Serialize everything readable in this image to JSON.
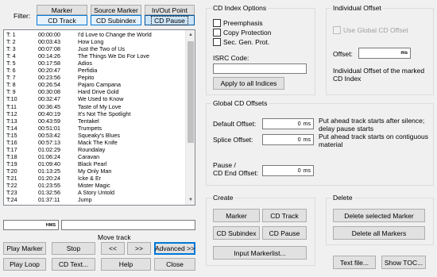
{
  "filter": {
    "label": "Filter:",
    "buttons": [
      "Marker",
      "Source Marker",
      "In/Out Point",
      "CD Track",
      "CD Subindex",
      "CD Pause"
    ]
  },
  "tracks": [
    {
      "id": "T: 1",
      "time": "00:00:00",
      "title": "I'd Love to Change the World"
    },
    {
      "id": "T: 2",
      "time": "00:03:43",
      "title": "How Long"
    },
    {
      "id": "T: 3",
      "time": "00:07:08",
      "title": "Just the Two of Us"
    },
    {
      "id": "T: 4",
      "time": "00:14:26",
      "title": "The Things We Do For Love"
    },
    {
      "id": "T: 5",
      "time": "00:17:58",
      "title": "Adios"
    },
    {
      "id": "T: 6",
      "time": "00:20:47",
      "title": "Perfidia"
    },
    {
      "id": "T: 7",
      "time": "00:23:56",
      "title": "Pepito"
    },
    {
      "id": "T: 8",
      "time": "00:26:54",
      "title": "Pajaro Campana"
    },
    {
      "id": "T: 9",
      "time": "00:30:08",
      "title": "Hard Drive Gold"
    },
    {
      "id": "T:10",
      "time": "00:32:47",
      "title": "We Used to Know"
    },
    {
      "id": "T:11",
      "time": "00:36:45",
      "title": "Taste of My Love"
    },
    {
      "id": "T:12",
      "time": "00:40:19",
      "title": "It's Not The Spotlight"
    },
    {
      "id": "T:13",
      "time": "00:43:59",
      "title": "Tentakel"
    },
    {
      "id": "T:14",
      "time": "00:51:01",
      "title": "Trumpets"
    },
    {
      "id": "T:15",
      "time": "00:53:42",
      "title": "Squeaky's Blues"
    },
    {
      "id": "T:16",
      "time": "00:57:13",
      "title": "Mack The Knife"
    },
    {
      "id": "T:17",
      "time": "01:02:29",
      "title": "Roundalay"
    },
    {
      "id": "T:18",
      "time": "01:06:24",
      "title": "Caravan"
    },
    {
      "id": "T:19",
      "time": "01:09:40",
      "title": "Black Pearl"
    },
    {
      "id": "T:20",
      "time": "01:13:25",
      "title": "My Only Man"
    },
    {
      "id": "T:21",
      "time": "01:20:24",
      "title": "Icke & Er"
    },
    {
      "id": "T:22",
      "time": "01:23:55",
      "title": "Mister Magic"
    },
    {
      "id": "T:23",
      "time": "01:32:56",
      "title": "A Story Untold"
    },
    {
      "id": "T:24",
      "time": "01:37:11",
      "title": "Jump"
    }
  ],
  "bottom": {
    "hms_unit": "HMS",
    "move_track_label": "Move track",
    "play_marker": "Play Marker",
    "stop": "Stop",
    "prev": "<<",
    "next": ">>",
    "advanced": "Advanced >>",
    "play_loop": "Play Loop",
    "cd_text": "CD Text...",
    "help": "Help",
    "close": "Close"
  },
  "cd_index": {
    "title": "CD Index Options",
    "preemphasis": "Preemphasis",
    "copy_protection": "Copy Protection",
    "sec_gen_prot": "Sec. Gen. Prot.",
    "isrc_label": "ISRC Code:",
    "isrc_value": "",
    "apply_all": "Apply to all Indices"
  },
  "individual_offset": {
    "title": "Individual Offset",
    "use_global": "Use Global CD Offset",
    "offset_label": "Offset:",
    "offset_unit": "ms",
    "offset_value": "",
    "description": "Individual Offset of the marked CD Index"
  },
  "global_offsets": {
    "title": "Global CD Offsets",
    "default_label": "Default Offset:",
    "default_value": "0",
    "default_unit": "ms",
    "default_desc": "Put ahead track starts after silence; delay pause starts",
    "splice_label": "Splice Offset:",
    "splice_value": "0",
    "splice_unit": "ms",
    "splice_desc": "Put ahead track starts on contiguous material",
    "pause_label_1": "Pause /",
    "pause_label_2": "CD End Offset:",
    "pause_value": "0",
    "pause_unit": "ms"
  },
  "create": {
    "title": "Create",
    "marker": "Marker",
    "cd_track": "CD Track",
    "cd_subindex": "CD Subindex",
    "cd_pause": "CD Pause",
    "input_markerlist": "Input Markerlist..."
  },
  "delete": {
    "title": "Delete",
    "delete_selected": "Delete selected Marker",
    "delete_all": "Delete all Markers"
  },
  "footer": {
    "text_file": "Text file...",
    "show_toc": "Show TOC..."
  }
}
